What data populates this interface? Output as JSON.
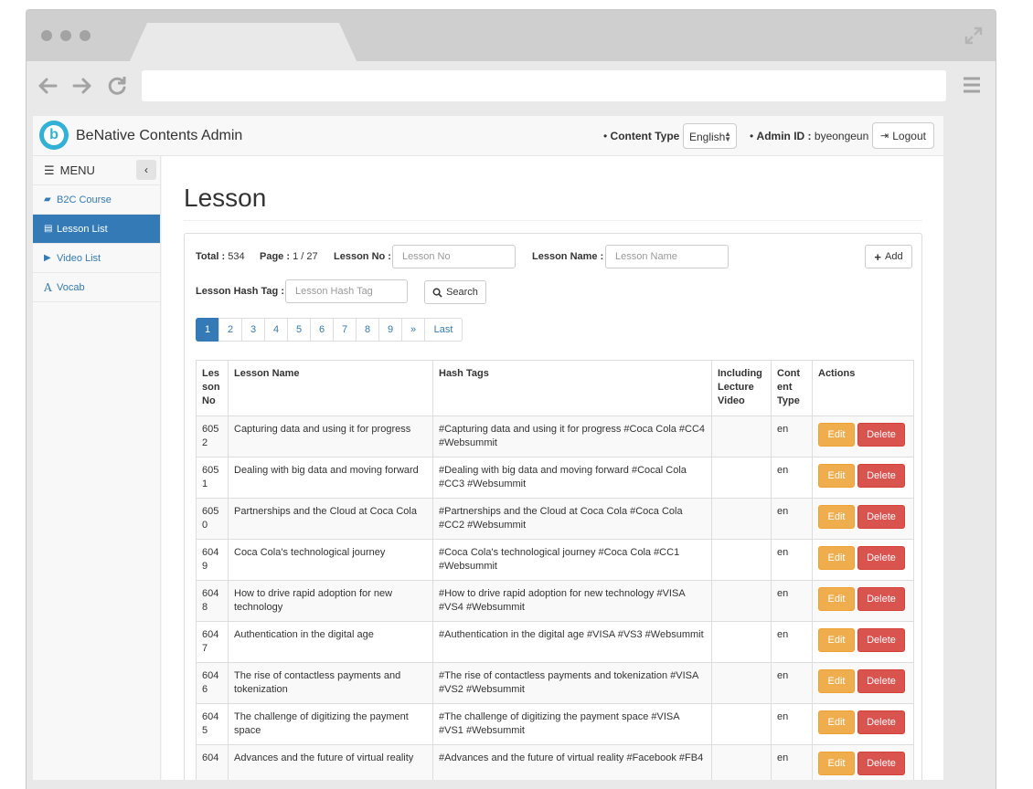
{
  "header": {
    "brand": "BeNative Contents Admin",
    "content_type_label": "Content Type :",
    "content_type_value": "English",
    "admin_id_label": "Admin ID :",
    "admin_id_value": "byeongeun",
    "logout_label": "Logout"
  },
  "sidebar": {
    "menu_label": "MENU",
    "items": [
      {
        "label": "B2C Course",
        "icon": "book-icon"
      },
      {
        "label": "Lesson List",
        "icon": "files-icon"
      },
      {
        "label": "Video List",
        "icon": "video-icon"
      },
      {
        "label": "Vocab",
        "icon": "font-icon"
      }
    ]
  },
  "page": {
    "title": "Lesson",
    "total_label": "Total :",
    "total_value": "534",
    "page_label": "Page :",
    "page_value": "1 / 27",
    "lesson_no_label": "Lesson No :",
    "lesson_no_placeholder": "Lesson No",
    "lesson_name_label": "Lesson Name :",
    "lesson_name_placeholder": "Lesson Name",
    "hash_tag_label": "Lesson Hash Tag :",
    "hash_tag_placeholder": "Lesson Hash Tag",
    "search_label": "Search",
    "add_label": "Add"
  },
  "pagination": [
    "1",
    "2",
    "3",
    "4",
    "5",
    "6",
    "7",
    "8",
    "9",
    "»",
    "Last"
  ],
  "table": {
    "headers": [
      "Les son No",
      "Lesson Name",
      "Hash Tags",
      "Including Lecture Video",
      "Cont ent Type",
      "Actions"
    ],
    "edit_label": "Edit",
    "delete_label": "Delete",
    "rows": [
      {
        "no": "605 2",
        "name": "Capturing data and using it for progress",
        "tags": "#Capturing data and using it for progress #Coca Cola #CC4 #Websummit",
        "video": "",
        "type": "en"
      },
      {
        "no": "605 1",
        "name": "Dealing with big data and moving forward",
        "tags": "#Dealing with big data and moving forward #Cocal Cola #CC3 #Websummit",
        "video": "",
        "type": "en"
      },
      {
        "no": "605 0",
        "name": "Partnerships and the Cloud at Coca Cola",
        "tags": "#Partnerships and the Cloud at Coca Cola #Coca Cola #CC2 #Websummit",
        "video": "",
        "type": "en"
      },
      {
        "no": "604 9",
        "name": "Coca Cola's technological journey",
        "tags": "#Coca Cola's technological journey #Coca Cola #CC1 #Websummit",
        "video": "",
        "type": "en"
      },
      {
        "no": "604 8",
        "name": "How to drive rapid adoption for new technology",
        "tags": "#How to drive rapid adoption for new technology #VISA #VS4 #Websummit",
        "video": "",
        "type": "en"
      },
      {
        "no": "604 7",
        "name": "Authentication in the digital age",
        "tags": "#Authentication in the digital age #VISA #VS3 #Websummit",
        "video": "",
        "type": "en"
      },
      {
        "no": "604 6",
        "name": "The rise of contactless payments and tokenization",
        "tags": "#The rise of contactless payments and tokenization #VISA #VS2 #Websummit",
        "video": "",
        "type": "en"
      },
      {
        "no": "604 5",
        "name": "The challenge of digitizing the payment space",
        "tags": "#The challenge of digitizing the payment space #VISA #VS1 #Websummit",
        "video": "",
        "type": "en"
      },
      {
        "no": "604",
        "name": "Advances and the future of virtual reality",
        "tags": "#Advances and the future of virtual reality #Facebook #FB4",
        "video": "",
        "type": "en"
      }
    ]
  },
  "colors": {
    "primary": "#337ab7",
    "edit": "#f0ad4e",
    "delete": "#d9534f",
    "logo": "#31b1d8"
  }
}
